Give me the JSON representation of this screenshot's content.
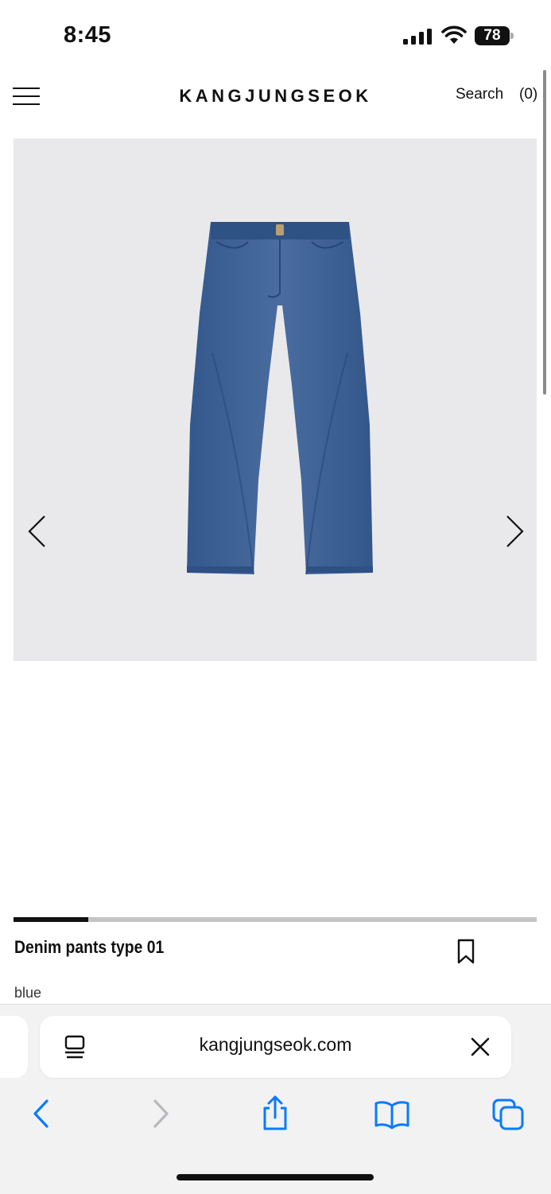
{
  "status_bar": {
    "time": "8:45",
    "battery": "78"
  },
  "header": {
    "brand": "KANGJUNGSEOK",
    "search_label": "Search",
    "cart_label": "(0)"
  },
  "gallery": {
    "image_subject": "jeans-photo",
    "current_slide_fraction": 0.143
  },
  "product": {
    "name": "Denim pants type 01",
    "color": "blue"
  },
  "browser": {
    "url": "kangjungseok.com"
  },
  "colors": {
    "accent_ios": "#0a7aff",
    "denim": "#3d5f92",
    "gallery_bg": "#e9e9eb"
  }
}
